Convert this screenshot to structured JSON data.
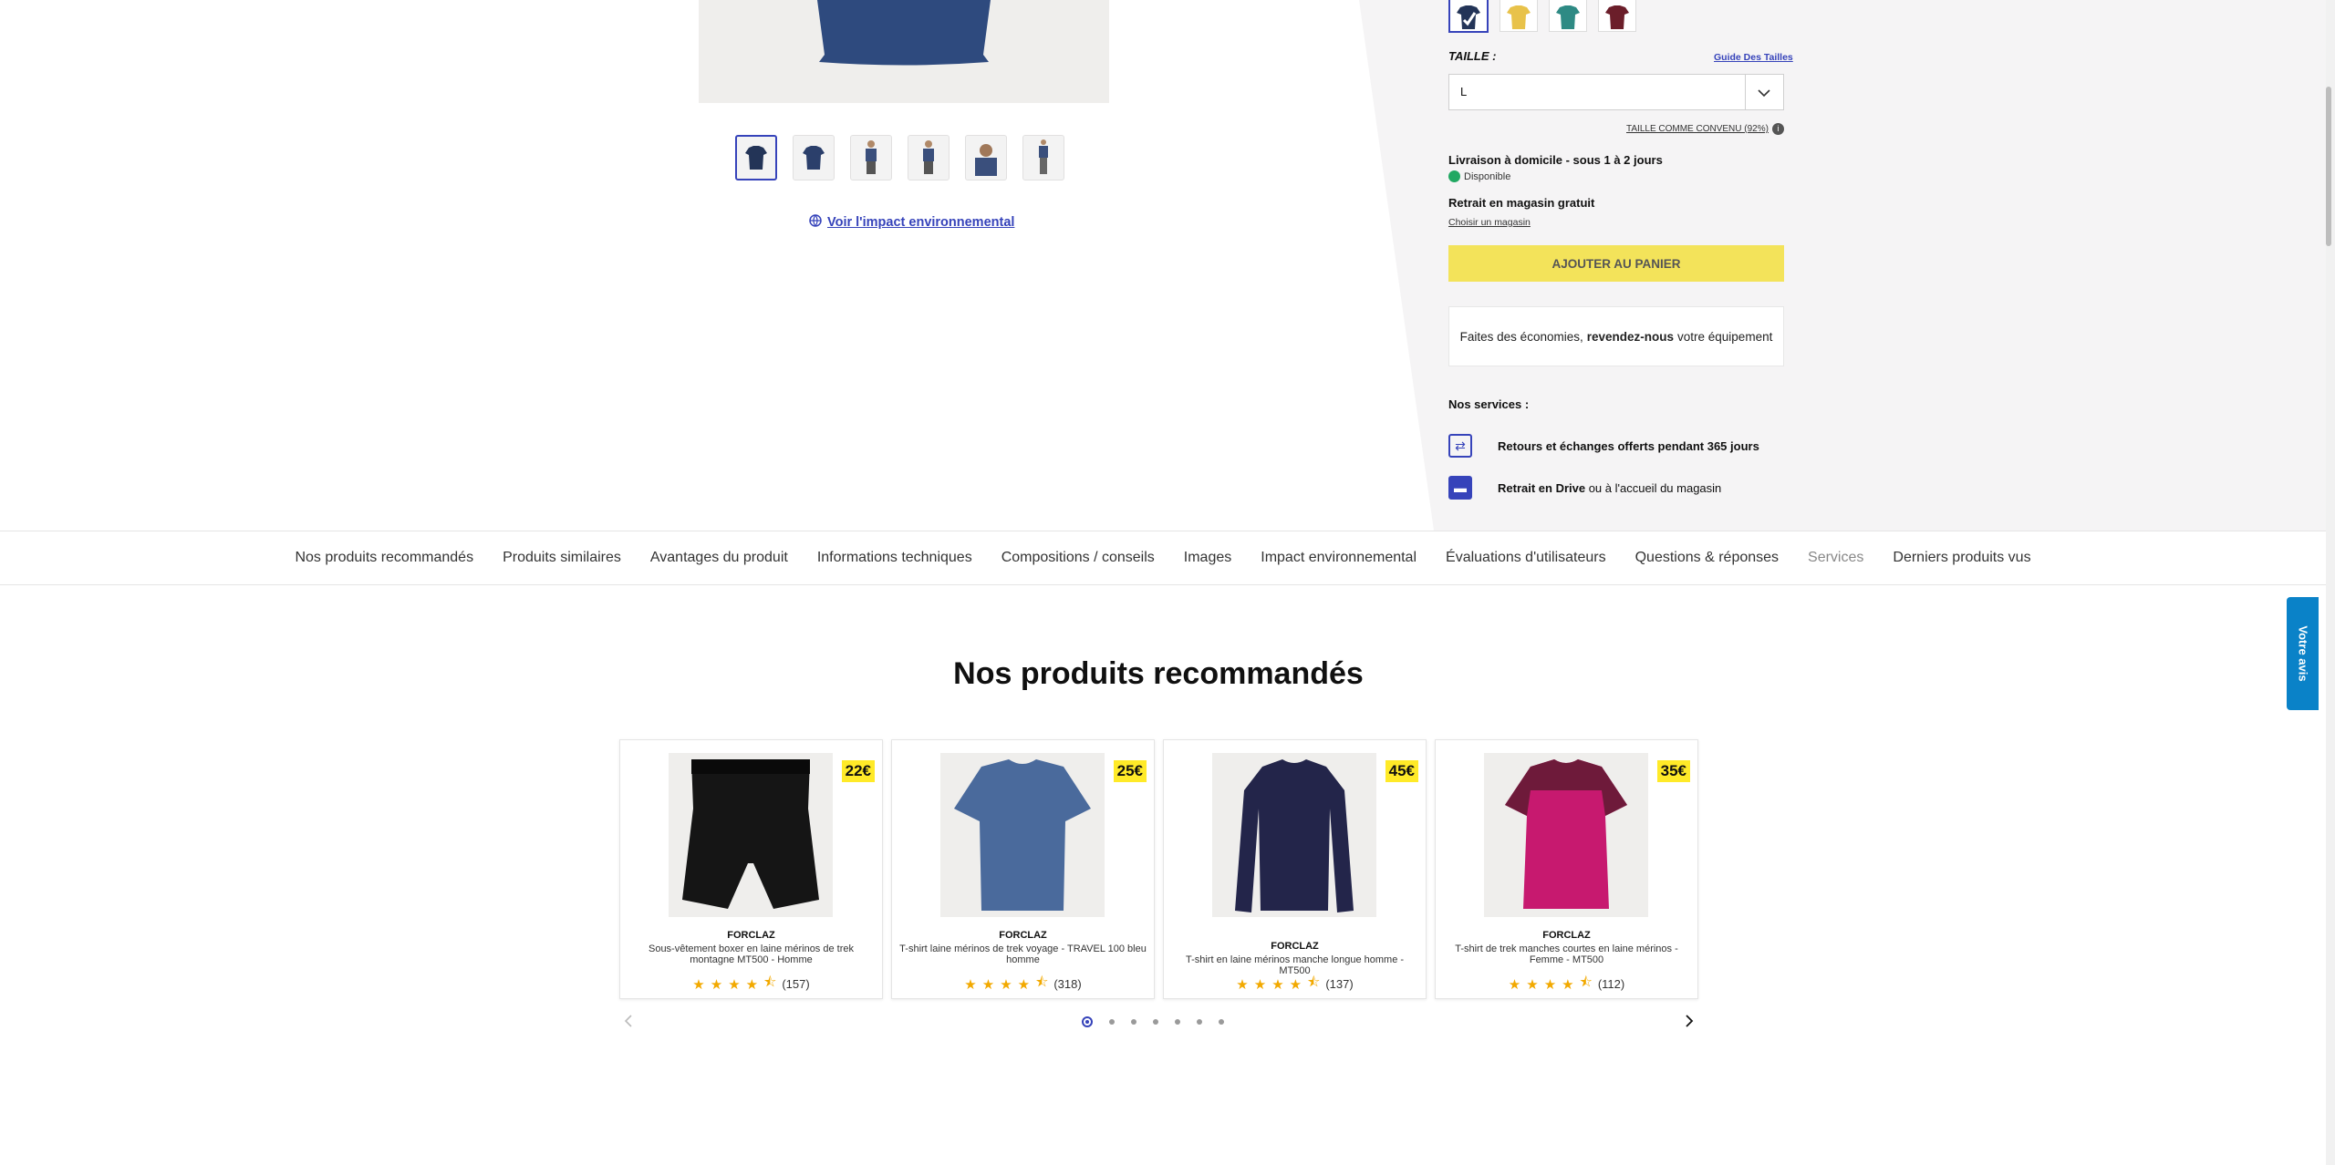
{
  "product": {
    "env_link": "Voir l'impact environnemental"
  },
  "right": {
    "taille_label": "TAILLE :",
    "guide_link": "Guide Des Tailles",
    "size_value": "L",
    "fit_text": "TAILLE COMME CONVENU (92%)",
    "delivery_title": "Livraison à domicile - sous 1 à 2 jours",
    "stock_status": "Disponible",
    "pickup_title": "Retrait en magasin gratuit",
    "pickup_link": "Choisir un magasin",
    "add_to_cart": "AJOUTER AU PANIER",
    "resell_pre": "Faites des économies, ",
    "resell_bold": "revendez-nous",
    "resell_post": " votre équipement",
    "services_title": "Nos services :",
    "service1": "Retours et échanges offerts pendant 365 jours",
    "service2_bold": "Retrait en Drive",
    "service2_rest": " ou à l'accueil du magasin",
    "swatch_colors": [
      "#2b3f6b",
      "#e8c24a",
      "#2e8a84",
      "#6b1e2a"
    ]
  },
  "nav": {
    "items": [
      "Nos produits recommandés",
      "Produits similaires",
      "Avantages du produit",
      "Informations techniques",
      "Compositions / conseils",
      "Images",
      "Impact environnemental",
      "Évaluations d'utilisateurs",
      "Questions & réponses",
      "Services",
      "Derniers produits vus"
    ]
  },
  "feedback_tab": "Votre avis",
  "recommended": {
    "title": "Nos produits recommandés",
    "products": [
      {
        "price": "22€",
        "brand": "FORCLAZ",
        "name": "Sous-vêtement boxer en laine mérinos de trek montagne MT500 - Homme",
        "reviews": "(157)",
        "color": "#151515"
      },
      {
        "price": "25€",
        "brand": "FORCLAZ",
        "name": "T-shirt laine mérinos de trek voyage - TRAVEL 100 bleu homme",
        "reviews": "(318)",
        "color": "#4a6a9c"
      },
      {
        "price": "45€",
        "brand": "FORCLAZ",
        "name": "T-shirt en laine mérinos manche longue homme - MT500",
        "reviews": "(137)",
        "color": "#23254a"
      },
      {
        "price": "35€",
        "brand": "FORCLAZ",
        "name": "T-shirt de trek manches courtes en laine mérinos - Femme - MT500",
        "reviews": "(112)",
        "color": "#c7196f"
      }
    ]
  }
}
